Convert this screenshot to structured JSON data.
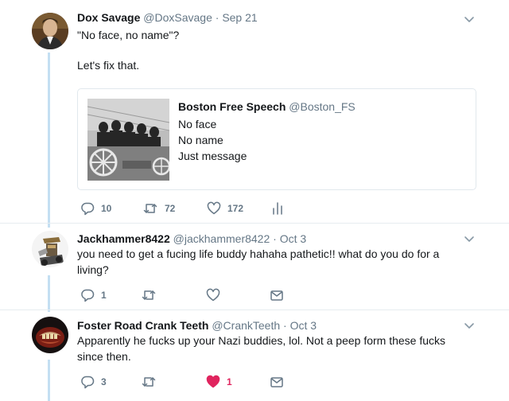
{
  "tweet": {
    "name": "Dox Savage",
    "handle": "@DoxSavage",
    "sep": "·",
    "date": "Sep 21",
    "line1": "\"No face, no name\"?",
    "line2": "Let's fix that.",
    "quote": {
      "name": "Boston Free Speech",
      "handle": "@Boston_FS",
      "lines": [
        "No face",
        "No name",
        "Just message"
      ]
    },
    "actions": {
      "replies": "10",
      "retweets": "72",
      "likes": "172"
    }
  },
  "replies": [
    {
      "name": "Jackhammer8422",
      "handle": "@jackhammer8422",
      "sep": "·",
      "date": "Oct 3",
      "lines": [
        "you need to get a fucing life buddy hahaha pathetic!! what do you do for a",
        "living?"
      ],
      "actions": {
        "replies": "1",
        "retweets": "",
        "likes": ""
      }
    },
    {
      "name": "Foster Road Crank Teeth",
      "handle": "@CrankTeeth",
      "sep": "·",
      "date": "Oct 3",
      "lines": [
        "Apparently he fucks up your Nazi buddies, lol. Not a peep form these fucks",
        "since then."
      ],
      "actions": {
        "replies": "3",
        "retweets": "",
        "likes": "1"
      }
    }
  ],
  "colors": {
    "text": "#14171a",
    "muted": "#657786",
    "thread": "#c4dff2",
    "like": "#e0245e",
    "border": "#e1e8ed"
  },
  "icons": [
    "chevron-down-icon",
    "reply-icon",
    "retweet-icon",
    "heart-icon",
    "analytics-icon",
    "direct-message-icon"
  ]
}
